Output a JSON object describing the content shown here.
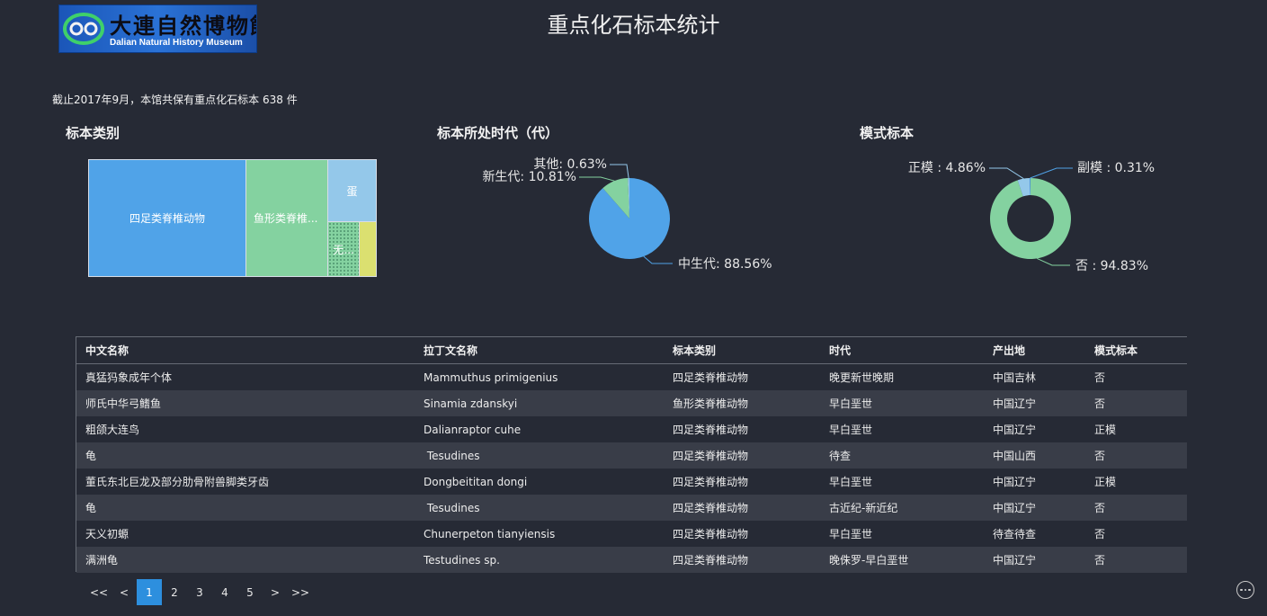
{
  "header": {
    "logo": {
      "cn": "大連自然博物館",
      "en": "Dalian Natural History Museum"
    },
    "title": "重点化石标本统计"
  },
  "summary": "截止2017年9月，本馆共保有重点化石标本  638 件",
  "sections": {
    "category": "标本类别",
    "era": "标本所处时代（代）",
    "type": "模式标本"
  },
  "treemap": {
    "cells": [
      {
        "label": "四足类脊椎动物",
        "color": "#50a3e8"
      },
      {
        "label": "鱼形类脊椎...",
        "color": "#84d2a0"
      },
      {
        "label": "蛋",
        "color": "#94c8ea"
      },
      {
        "label": "无...",
        "color": "#84d2a0"
      },
      {
        "label": "",
        "color": "#dbe070"
      }
    ]
  },
  "chart_data": [
    {
      "type": "pie",
      "title": "标本所处时代（代）",
      "labels": [
        "中生代",
        "新生代",
        "其他"
      ],
      "values": [
        88.56,
        10.81,
        0.63
      ],
      "colors": [
        "#50a3e8",
        "#84d2a0",
        "#94c8ea"
      ],
      "label_texts": [
        "中生代: 88.56%",
        "新生代: 10.81%",
        "其他: 0.63%"
      ]
    },
    {
      "type": "pie",
      "title": "模式标本",
      "labels": [
        "否",
        "正模",
        "副模"
      ],
      "values": [
        94.83,
        4.86,
        0.31
      ],
      "colors": [
        "#84d2a0",
        "#94c8ea",
        "#50a3e8"
      ],
      "label_texts": [
        "否 : 94.83%",
        "正模 : 4.86%",
        "副模 : 0.31%"
      ]
    }
  ],
  "table": {
    "headers": [
      "中文名称",
      "拉丁文名称",
      "标本类别",
      "时代",
      "产出地",
      "模式标本"
    ],
    "rows": [
      [
        "真猛犸象成年个体",
        "Mammuthus primigenius",
        "四足类脊椎动物",
        "晚更新世晚期",
        "中国吉林",
        "否"
      ],
      [
        "师氏中华弓鳍鱼",
        "Sinamia zdanskyi",
        "鱼形类脊椎动物",
        "早白垩世",
        "中国辽宁",
        "否"
      ],
      [
        "粗颌大连鸟",
        "Dalianraptor cuhe",
        "四足类脊椎动物",
        "早白垩世",
        "中国辽宁",
        "正模"
      ],
      [
        "龟",
        " Tesudines",
        "四足类脊椎动物",
        "待查",
        "中国山西",
        "否"
      ],
      [
        "董氏东北巨龙及部分肋骨附兽脚类牙齿",
        "Dongbeititan dongi",
        "四足类脊椎动物",
        "早白垩世",
        "中国辽宁",
        "正模"
      ],
      [
        "龟",
        " Tesudines",
        "四足类脊椎动物",
        "古近纪-新近纪",
        "中国辽宁",
        "否"
      ],
      [
        "天义初螈",
        "Chunerpeton tianyiensis",
        "四足类脊椎动物",
        "早白垩世",
        "待查待查",
        "否"
      ],
      [
        "满洲龟",
        "Testudines sp.",
        "四足类脊椎动物",
        "晚侏罗-早白垩世",
        "中国辽宁",
        "否"
      ]
    ]
  },
  "pagination": {
    "items": [
      "<<",
      "<",
      "1",
      "2",
      "3",
      "4",
      "5",
      ">",
      ">>"
    ],
    "active": "1"
  }
}
